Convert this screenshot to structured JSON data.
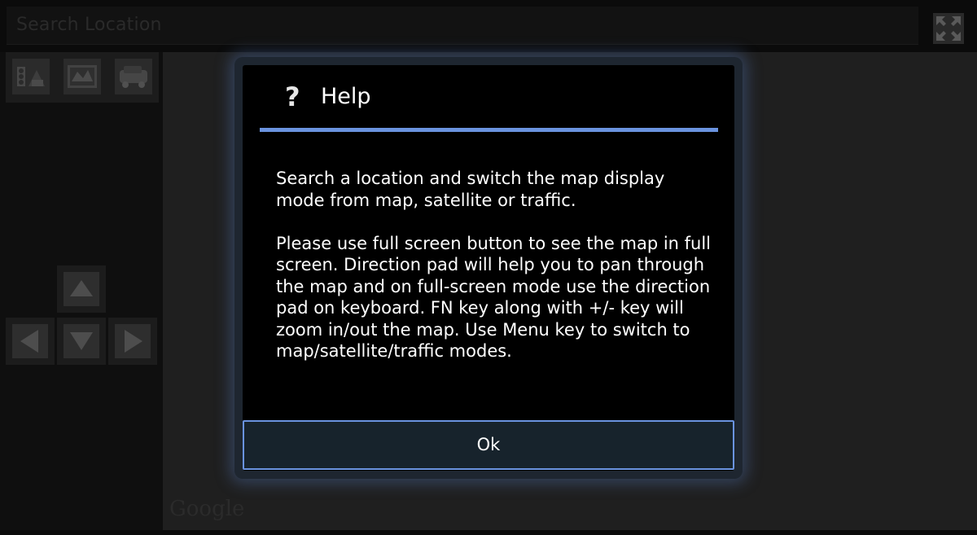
{
  "search": {
    "placeholder": "Search Location"
  },
  "toolbar": {
    "fullscreen_icon": "fullscreen-icon",
    "modes": [
      {
        "icon": "traffic-mode-icon"
      },
      {
        "icon": "map-mode-icon"
      },
      {
        "icon": "satellite-mode-icon"
      }
    ]
  },
  "dpad": {
    "up_icon": "arrow-up-icon",
    "left_icon": "arrow-left-icon",
    "down_icon": "arrow-down-icon",
    "right_icon": "arrow-right-icon"
  },
  "map": {
    "attribution": "Google"
  },
  "dialog": {
    "icon": "?",
    "title": "Help",
    "message": "Search a location and switch the map display mode from map, satellite or traffic.\n\n Please use full screen button to see the map in full screen. Direction pad will help you to pan through the map and on full-screen mode use the direction pad on keyboard. FN key along with +/- key will zoom in/out the map. Use Menu key to switch to map/satellite/traffic modes.",
    "ok_label": "Ok"
  },
  "colors": {
    "accent": "#6a93df",
    "dialog_background": "#000000",
    "ok_button_background": "#17232c"
  }
}
